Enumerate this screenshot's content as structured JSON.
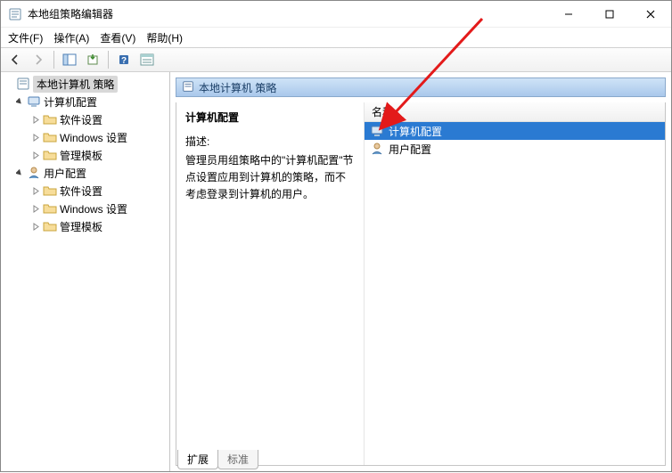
{
  "window": {
    "title": "本地组策略编辑器"
  },
  "menu": {
    "file": "文件(F)",
    "action": "操作(A)",
    "view": "查看(V)",
    "help": "帮助(H)"
  },
  "tree": {
    "root": "本地计算机 策略",
    "computer": "计算机配置",
    "user": "用户配置",
    "software": "软件设置",
    "windows": "Windows 设置",
    "templates": "管理模板"
  },
  "details": {
    "header": "本地计算机 策略",
    "section_title": "计算机配置",
    "desc_label": "描述:",
    "desc_text": "管理员用组策略中的\"计算机配置\"节点设置应用到计算机的策略，而不考虑登录到计算机的用户。",
    "col_name": "名称",
    "rows": {
      "r1": "计算机配置",
      "r2": "用户配置"
    }
  },
  "tabs": {
    "extended": "扩展",
    "standard": "标准"
  }
}
